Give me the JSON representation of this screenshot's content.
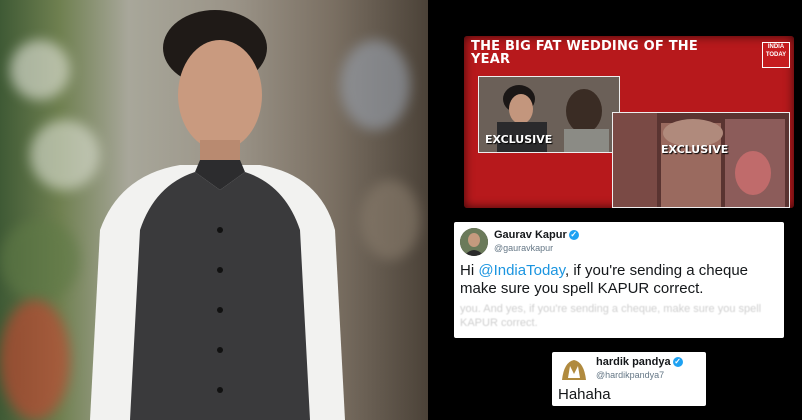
{
  "tv": {
    "title": "THE BIG FAT WEDDING OF THE YEAR",
    "logo_text": "INDIA TODAY",
    "clip1_label": "EXCLUSIVE",
    "clip2_label": "EXCLUSIVE"
  },
  "tweet1": {
    "name": "Gaurav Kapur",
    "handle": "@gauravkapur",
    "text_prefix": "Hi ",
    "mention": "@IndiaToday",
    "text_suffix": ", if you're sending a cheque make sure you spell KAPUR correct.",
    "faded_text": "you. And yes, if you're sending a cheque, make sure you spell KAPUR correct."
  },
  "tweet2": {
    "name": "hardik pandya",
    "handle": "@hardikpandya7",
    "text": "Hahaha"
  },
  "colors": {
    "tv_red": "#b7191c",
    "mention_blue": "#1b95e0",
    "verified_blue": "#1da1f2"
  }
}
